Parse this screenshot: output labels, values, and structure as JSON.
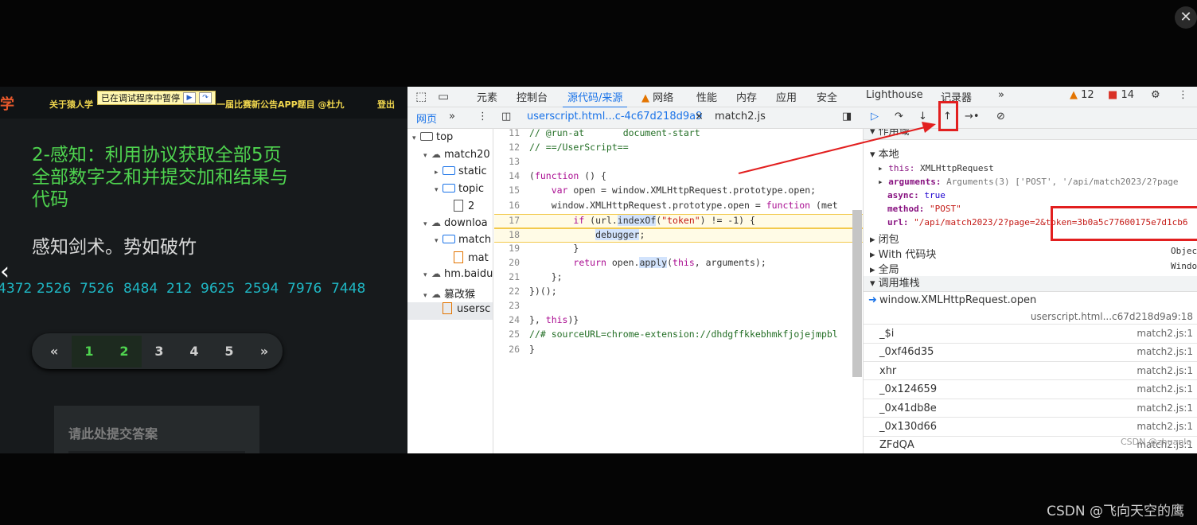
{
  "viewer": {
    "close_label": "✕"
  },
  "game": {
    "logo": "学",
    "nav_left": "关于猿人学",
    "nav_mid": "一届比赛新公告APP题目 @杜九",
    "nav_login": "登出",
    "paused_banner": "已在调试程序中暂停",
    "question_title": "2-感知：利用协议获取全部5页全部数字之和并提交加和结果与代码",
    "question_sub": "感知剑术。势如破竹",
    "numbers": [
      "4372",
      "2526",
      "7526",
      "8484",
      "212",
      "9625",
      "2594",
      "7976",
      "7448"
    ],
    "pager": [
      "«",
      "1",
      "2",
      "3",
      "4",
      "5",
      "»"
    ],
    "active_page": "2",
    "submit_label": "请此处提交答案"
  },
  "devtools": {
    "tabs": [
      "元素",
      "控制台",
      "源代码/来源",
      "网络",
      "性能",
      "内存",
      "应用",
      "安全",
      "Lighthouse",
      "记录器"
    ],
    "active_tab": "源代码/来源",
    "more": "»",
    "warn_count": "12",
    "err_count": "14",
    "nav_tab": "网页",
    "file_tabs": [
      "userscript.html...c-4c67d218d9a9",
      "match2.js"
    ],
    "tree": [
      {
        "label": "top",
        "indent": 0,
        "kind": "frame"
      },
      {
        "label": "match20",
        "indent": 1,
        "kind": "cloud"
      },
      {
        "label": "static",
        "indent": 2,
        "kind": "folder"
      },
      {
        "label": "topic",
        "indent": 2,
        "kind": "folder"
      },
      {
        "label": "2",
        "indent": 3,
        "kind": "file"
      },
      {
        "label": "downloa",
        "indent": 1,
        "kind": "cloud"
      },
      {
        "label": "match",
        "indent": 2,
        "kind": "folder"
      },
      {
        "label": "mat",
        "indent": 3,
        "kind": "file-orange"
      },
      {
        "label": "hm.baidu",
        "indent": 1,
        "kind": "cloud"
      },
      {
        "label": "篡改猴",
        "indent": 1,
        "kind": "cloud"
      },
      {
        "label": "usersc",
        "indent": 2,
        "kind": "file-orange"
      }
    ],
    "code": [
      {
        "n": "11",
        "t": "// @run-at       document-start"
      },
      {
        "n": "12",
        "t": "// ==/UserScript=="
      },
      {
        "n": "13",
        "t": ""
      },
      {
        "n": "14",
        "t": "(function () {"
      },
      {
        "n": "15",
        "t": "    var open = window.XMLHttpRequest.prototype.open;"
      },
      {
        "n": "16",
        "t": "    window.XMLHttpRequest.prototype.open = function (met"
      },
      {
        "n": "17",
        "t": "        if (url.indexOf(\"token\") != -1) {"
      },
      {
        "n": "18",
        "t": "            debugger;"
      },
      {
        "n": "19",
        "t": "        }"
      },
      {
        "n": "20",
        "t": "        return open.apply(this, arguments);"
      },
      {
        "n": "21",
        "t": "    };"
      },
      {
        "n": "22",
        "t": "})();"
      },
      {
        "n": "23",
        "t": ""
      },
      {
        "n": "24",
        "t": "}, this)}"
      },
      {
        "n": "25",
        "t": "//# sourceURL=chrome-extension://dhdgffkkebhmkfjojejmpbl"
      },
      {
        "n": "26",
        "t": "}"
      }
    ],
    "scope": {
      "scope_header": "作用域",
      "local": "本地",
      "this_key": "this:",
      "this_val": "XMLHttpRequest",
      "args_key": "arguments:",
      "args_val": "Arguments(3)  ['POST', '/api/match2023/2?page",
      "async_key": "async:",
      "async_val": "true",
      "method_key": "method:",
      "method_val": "\"POST\"",
      "url_key": "url:",
      "url_val": "\"/api/match2023/2?page=2&token=3b0a5c77600175e7d1cb6",
      "closure": "闭包",
      "with_block": "With 代码块",
      "with_val": "Objec",
      "global": "全局",
      "global_val": "Windo"
    },
    "callstack_header": "调用堆栈",
    "callstack": [
      {
        "fn": "window.XMLHttpRequest.open",
        "loc": "userscript.html...c67d218d9a9:18"
      },
      {
        "fn": "_$i",
        "loc": "match2.js:1"
      },
      {
        "fn": "_0xf46d35",
        "loc": "match2.js:1"
      },
      {
        "fn": "xhr",
        "loc": "match2.js:1"
      },
      {
        "fn": "_0x124659",
        "loc": "match2.js:1"
      },
      {
        "fn": "_0x41db8e",
        "loc": "match2.js:1"
      },
      {
        "fn": "_0x130d66",
        "loc": "match2.js:1"
      },
      {
        "fn": "ZFdQA",
        "loc": "match2.js:1"
      }
    ],
    "watermark": "CSDN @zhuanlo"
  },
  "caption": "CSDN @飞向天空的鹰"
}
